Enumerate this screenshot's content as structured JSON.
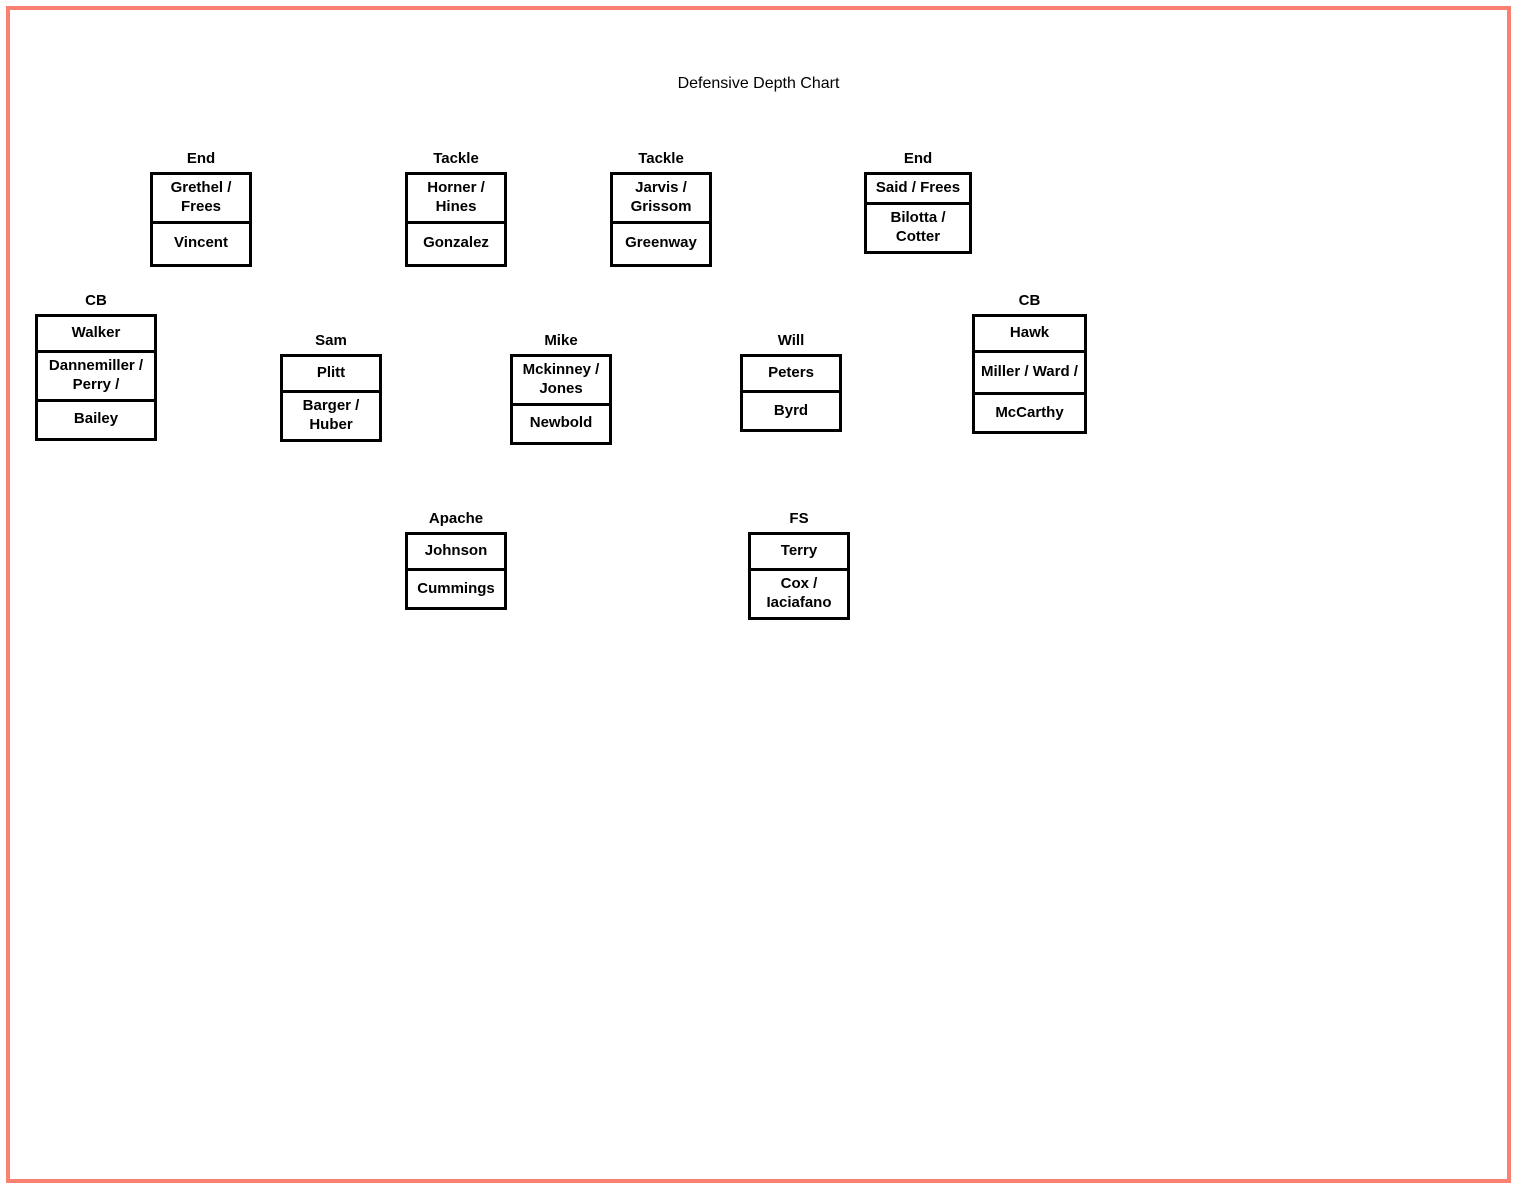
{
  "title": "Defensive Depth Chart",
  "chart_data": {
    "type": "table",
    "title": "Defensive Depth Chart",
    "positions": [
      {
        "row": "DL",
        "label": "End",
        "depth": [
          "Grethel / Frees",
          "Vincent"
        ]
      },
      {
        "row": "DL",
        "label": "Tackle",
        "depth": [
          "Horner / Hines",
          "Gonzalez"
        ]
      },
      {
        "row": "DL",
        "label": "Tackle",
        "depth": [
          "Jarvis / Grissom",
          "Greenway"
        ]
      },
      {
        "row": "DL",
        "label": "End",
        "depth": [
          "Said / Frees",
          "Bilotta / Cotter"
        ]
      },
      {
        "row": "LB",
        "label": "CB",
        "depth": [
          "Walker",
          "Dannemiller / Perry /",
          "Bailey"
        ]
      },
      {
        "row": "LB",
        "label": "Sam",
        "depth": [
          "Plitt",
          "Barger / Huber"
        ]
      },
      {
        "row": "LB",
        "label": "Mike",
        "depth": [
          "Mckinney / Jones",
          "Newbold"
        ]
      },
      {
        "row": "LB",
        "label": "Will",
        "depth": [
          "Peters",
          "Byrd"
        ]
      },
      {
        "row": "LB",
        "label": "CB",
        "depth": [
          "Hawk",
          "Miller / Ward /",
          "McCarthy"
        ]
      },
      {
        "row": "DB",
        "label": "Apache",
        "depth": [
          "Johnson",
          "Cummings"
        ]
      },
      {
        "row": "DB",
        "label": "FS",
        "depth": [
          "Terry",
          "Cox / Iaciafano"
        ]
      }
    ]
  },
  "dl": {
    "end_left": {
      "label": "End",
      "c0": "Grethel / Frees",
      "c1": "Vincent"
    },
    "tackle_left": {
      "label": "Tackle",
      "c0": "Horner / Hines",
      "c1": "Gonzalez"
    },
    "tackle_right": {
      "label": "Tackle",
      "c0": "Jarvis / Grissom",
      "c1": "Greenway"
    },
    "end_right": {
      "label": "End",
      "c0": "Said / Frees",
      "c1": "Bilotta / Cotter"
    }
  },
  "lb": {
    "cb_left": {
      "label": "CB",
      "c0": "Walker",
      "c1": "Dannemiller / Perry /",
      "c2": "Bailey"
    },
    "sam": {
      "label": "Sam",
      "c0": "Plitt",
      "c1": "Barger / Huber"
    },
    "mike": {
      "label": "Mike",
      "c0": "Mckinney / Jones",
      "c1": "Newbold"
    },
    "will": {
      "label": "Will",
      "c0": "Peters",
      "c1": "Byrd"
    },
    "cb_right": {
      "label": "CB",
      "c0": "Hawk",
      "c1": "Miller / Ward /",
      "c2": "McCarthy"
    }
  },
  "db": {
    "apache": {
      "label": "Apache",
      "c0": "Johnson",
      "c1": "Cummings"
    },
    "fs": {
      "label": "FS",
      "c0": "Terry",
      "c1": "Cox / Iaciafano"
    }
  }
}
